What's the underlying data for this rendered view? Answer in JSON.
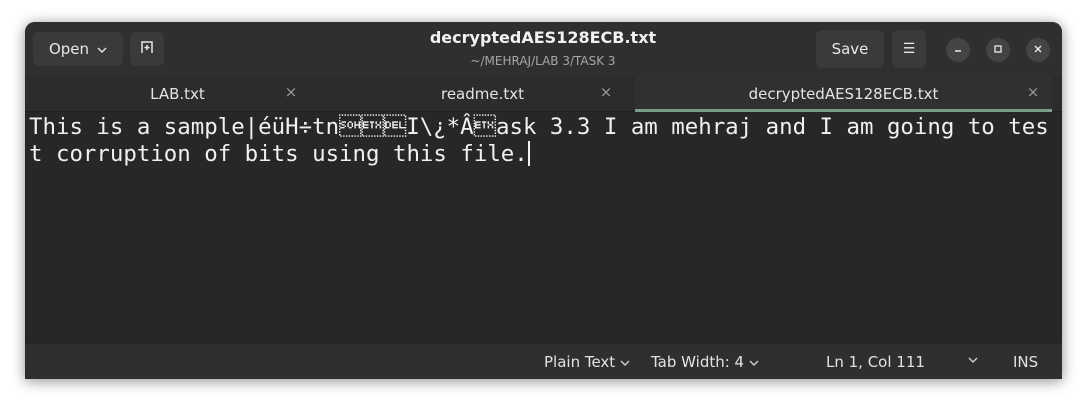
{
  "window": {
    "title": "decryptedAES128ECB.txt",
    "subtitle": "~/MEHRAJ/LAB 3/TASK 3"
  },
  "header": {
    "open_label": "Open",
    "save_label": "Save",
    "menu_icon": "☰",
    "minimize_icon": "—",
    "maximize_icon": "□",
    "close_icon": "✕"
  },
  "tabs": [
    {
      "label": "LAB.txt",
      "close": "×",
      "active": false
    },
    {
      "label": "readme.txt",
      "close": "×",
      "active": false
    },
    {
      "label": "decryptedAES128ECB.txt",
      "close": "×",
      "active": true
    }
  ],
  "editor": {
    "content": "This is a sample|éüH÷tn\u0001\u0003I\\¿*Â\u0003ask 3.3 I am mehraj and I am going to test corruption of bits using this file."
  },
  "statusbar": {
    "syntax": "Plain Text",
    "tab_width": "Tab Width: 4",
    "position": "Ln 1, Col 111",
    "mode": "INS"
  },
  "colors": {
    "window_bg": "#2b2b2b",
    "editor_bg": "#272727",
    "active_tab_accent": "#7a9a8a",
    "text": "#f0f0f0"
  }
}
